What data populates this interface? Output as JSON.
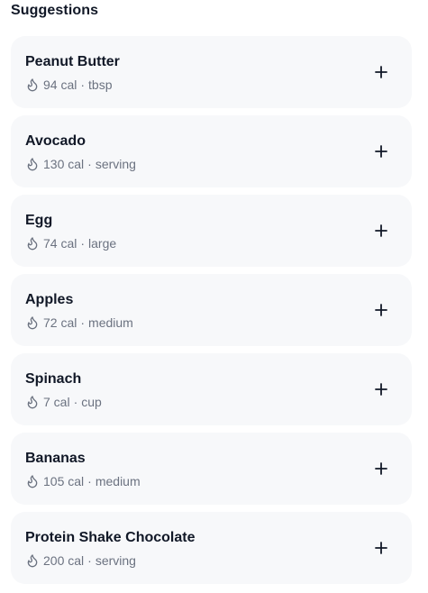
{
  "section": {
    "title": "Suggestions"
  },
  "suggestions": [
    {
      "name": "Peanut Butter",
      "calories": "94 cal",
      "unit": "tbsp"
    },
    {
      "name": "Avocado",
      "calories": "130 cal",
      "unit": "serving"
    },
    {
      "name": "Egg",
      "calories": "74 cal",
      "unit": "large"
    },
    {
      "name": "Apples",
      "calories": "72 cal",
      "unit": "medium"
    },
    {
      "name": "Spinach",
      "calories": "7 cal",
      "unit": "cup"
    },
    {
      "name": "Bananas",
      "calories": "105 cal",
      "unit": "medium"
    },
    {
      "name": "Protein Shake Chocolate",
      "calories": "200 cal",
      "unit": "serving"
    }
  ],
  "meta_separator": "·",
  "icons": {
    "calorie": "flame-icon",
    "add": "plus-icon"
  },
  "colors": {
    "card_background": "#f7f8fa",
    "title_text": "#111827",
    "meta_text": "#6b7280"
  }
}
